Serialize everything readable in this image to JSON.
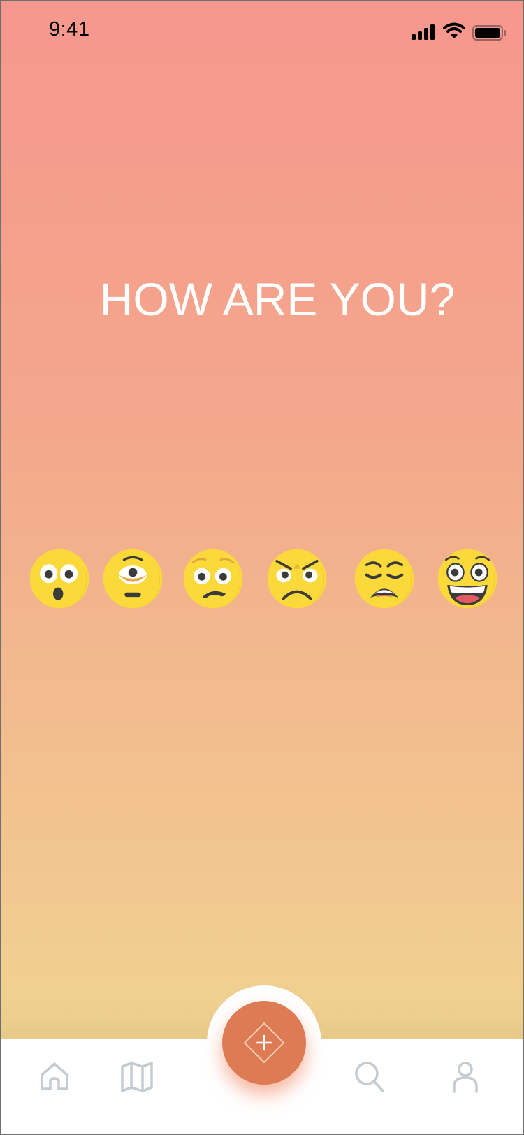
{
  "status_bar": {
    "time": "9:41"
  },
  "title": "HOW ARE YOU?",
  "moods": [
    {
      "icon": "surprised-face-icon"
    },
    {
      "icon": "one-eyed-face-icon"
    },
    {
      "icon": "worried-face-icon"
    },
    {
      "icon": "angry-face-icon"
    },
    {
      "icon": "tired-face-icon"
    },
    {
      "icon": "grinning-face-icon"
    }
  ],
  "fab": {
    "icon": "plus-diamond-icon"
  },
  "tabs": [
    {
      "icon": "home-icon"
    },
    {
      "icon": "map-icon"
    },
    {
      "icon": "search-icon"
    },
    {
      "icon": "profile-icon"
    }
  ],
  "colors": {
    "gradient_top": "#f6978d",
    "gradient_bottom": "#f0d391",
    "accent": "#dc7b54",
    "emoji_yellow": "#fbd93b",
    "tab_icon": "#c4cbd1"
  }
}
